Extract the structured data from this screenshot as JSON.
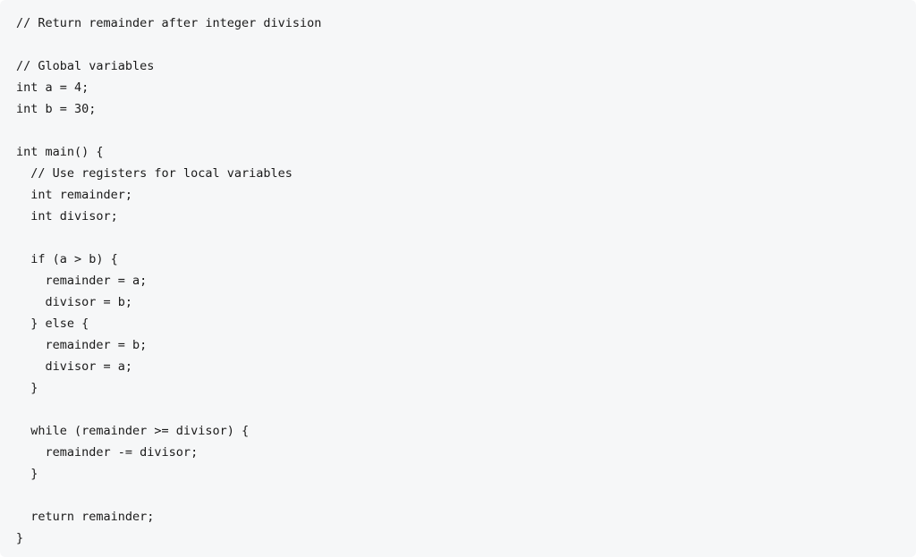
{
  "code": {
    "line1": "// Return remainder after integer division",
    "line2": "",
    "line3": "// Global variables",
    "line4": "int a = 4;",
    "line5": "int b = 30;",
    "line6": "",
    "line7": "int main() {",
    "line8": "  // Use registers for local variables",
    "line9": "  int remainder;",
    "line10": "  int divisor;",
    "line11": "",
    "line12": "  if (a > b) {",
    "line13": "    remainder = a;",
    "line14": "    divisor = b;",
    "line15": "  } else {",
    "line16": "    remainder = b;",
    "line17": "    divisor = a;",
    "line18": "  }",
    "line19": "",
    "line20": "  while (remainder >= divisor) {",
    "line21": "    remainder -= divisor;",
    "line22": "  }",
    "line23": "",
    "line24": "  return remainder;",
    "line25": "}"
  }
}
